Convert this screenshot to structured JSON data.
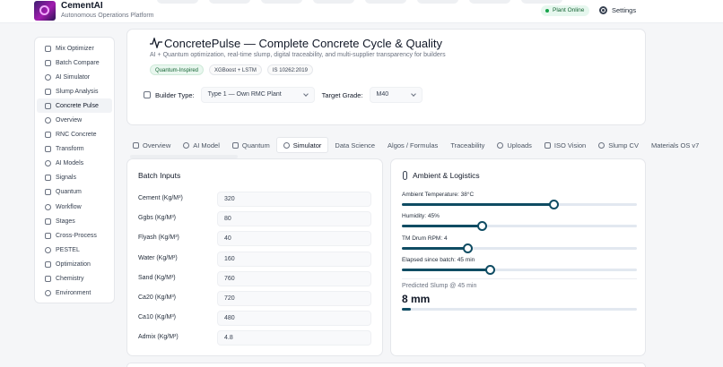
{
  "header": {
    "brand_title": "CementAI",
    "brand_subtitle": "Autonomous Operations Platform",
    "status": "Plant Online",
    "settings_label": "Settings"
  },
  "sidebar": {
    "items": [
      {
        "label": "Mix Optimizer",
        "icon": "flask-icon",
        "active": false
      },
      {
        "label": "Batch Compare",
        "icon": "compare-icon",
        "active": false
      },
      {
        "label": "AI Simulator",
        "icon": "simulator-icon",
        "active": false
      },
      {
        "label": "Slump Analysis",
        "icon": "wave-icon",
        "active": false
      },
      {
        "label": "Concrete Pulse",
        "icon": "pulse-icon",
        "active": true
      },
      {
        "label": "Overview",
        "icon": "grid-icon",
        "active": false
      },
      {
        "label": "RNC Concrete",
        "icon": "truck-icon",
        "active": false
      },
      {
        "label": "Transform",
        "icon": "transform-icon",
        "active": false
      },
      {
        "label": "AI Models",
        "icon": "chip-icon",
        "active": false
      },
      {
        "label": "Signals",
        "icon": "signal-icon",
        "active": false
      },
      {
        "label": "Quantum",
        "icon": "atom-icon",
        "active": false
      },
      {
        "label": "Workflow",
        "icon": "workflow-icon",
        "active": false
      },
      {
        "label": "Stages",
        "icon": "stages-icon",
        "active": false
      },
      {
        "label": "Cross-Process",
        "icon": "cross-process-icon",
        "active": false
      },
      {
        "label": "PESTEL",
        "icon": "globe-icon",
        "active": false
      },
      {
        "label": "Optimization",
        "icon": "sliders-icon",
        "active": false
      },
      {
        "label": "Chemistry",
        "icon": "chemistry-icon",
        "active": false
      },
      {
        "label": "Environment",
        "icon": "leaf-icon",
        "active": false
      }
    ]
  },
  "main": {
    "title": "ConcretePulse — Complete Concrete Cycle & Quality",
    "subtitle": "AI + Quantum optimization, real-time slump, digital traceability, and multi-supplier transparency for builders",
    "badges": [
      "Quantum-Inspired",
      "XGBoost + LSTM",
      "IS 10262:2019"
    ],
    "builder_type_label": "Builder Type:",
    "builder_type_value": "Type 1 — Own RMC Plant",
    "target_grade_label": "Target Grade:",
    "target_grade_value": "M40"
  },
  "tabs": [
    {
      "label": "Overview",
      "active": false
    },
    {
      "label": "AI Model",
      "active": false
    },
    {
      "label": "Quantum",
      "active": false
    },
    {
      "label": "Simulator",
      "active": true
    },
    {
      "label": "Data Science",
      "active": false
    },
    {
      "label": "Algos / Formulas",
      "active": false
    },
    {
      "label": "Traceability",
      "active": false
    },
    {
      "label": "Uploads",
      "active": false
    },
    {
      "label": "ISO Vision",
      "active": false
    },
    {
      "label": "Slump CV",
      "active": false
    },
    {
      "label": "Materials OS v7",
      "active": false
    }
  ],
  "batch": {
    "title": "Batch Inputs",
    "rows": [
      {
        "label": "Cement (Kg/M³)",
        "value": "320"
      },
      {
        "label": "Ggbs (Kg/M³)",
        "value": "80"
      },
      {
        "label": "Flyash (Kg/M³)",
        "value": "40"
      },
      {
        "label": "Water (Kg/M³)",
        "value": "160"
      },
      {
        "label": "Sand (Kg/M³)",
        "value": "760"
      },
      {
        "label": "Ca20 (Kg/M³)",
        "value": "720"
      },
      {
        "label": "Ca10 (Kg/M³)",
        "value": "480"
      },
      {
        "label": "Admix (Kg/M³)",
        "value": "4.8"
      }
    ]
  },
  "ambient": {
    "title": "Ambient & Logistics",
    "sliders": [
      {
        "label": "Ambient Temperature: 38°C",
        "fraction": 0.646
      },
      {
        "label": "Humidity: 45%",
        "fraction": 0.338
      },
      {
        "label": "TM Drum RPM: 4",
        "fraction": 0.277
      },
      {
        "label": "Elapsed since batch: 45 min",
        "fraction": 0.375
      }
    ],
    "prediction_label": "Predicted Slump @ 45 min",
    "prediction_value": "8 mm",
    "prediction_fraction": 0.04
  },
  "colors": {
    "accent": "#0f4c63",
    "online": "#16a34a"
  }
}
